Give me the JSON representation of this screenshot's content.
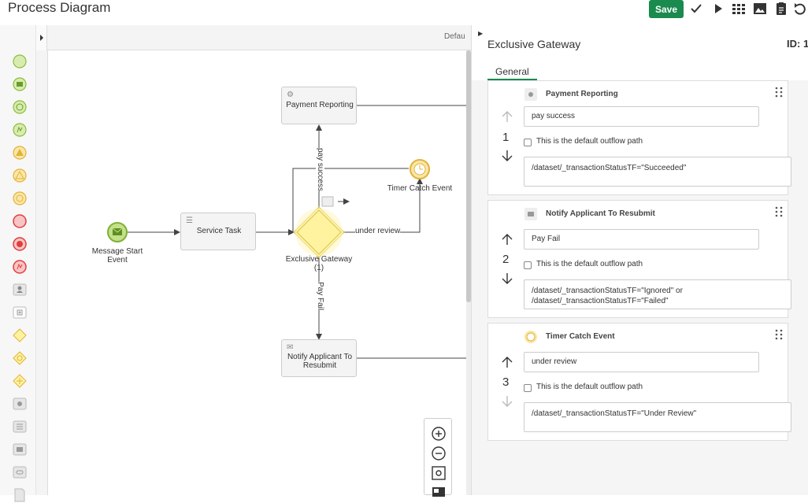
{
  "header": {
    "title": "Process Diagram",
    "save_label": "Save",
    "tools": [
      "check-icon",
      "play-icon",
      "grid-icon",
      "image-icon",
      "clipboard-icon",
      "undo-icon"
    ]
  },
  "canvas": {
    "default_label": "Defau",
    "elements": {
      "start_event": "Message Start\nEvent",
      "service_task": "Service Task",
      "payment_reporting": "Payment Reporting",
      "gateway": "Exclusive Gateway\n(1)",
      "timer": "Timer Catch Event",
      "notify": "Notify Applicant To\nResubmit",
      "flow_pay_success": "pay success",
      "flow_under_review": "under review",
      "flow_pay_fail": "Pay Fail"
    }
  },
  "panel": {
    "title": "Exclusive Gateway",
    "id_label": "ID: 1",
    "tab": "General",
    "flows": [
      {
        "target": "Payment Reporting",
        "icon": "gear-icon",
        "order": "1",
        "condition_name": "pay success",
        "default_label": "This is the default outflow path",
        "expression": "/dataset/_transactionStatusTF=\"Succeeded\""
      },
      {
        "target": "Notify Applicant To Resubmit",
        "icon": "envelope-icon",
        "order": "2",
        "condition_name": "Pay Fail",
        "default_label": "This is the default outflow path",
        "expression": "/dataset/_transactionStatusTF=\"Ignored\" or\n/dataset/_transactionStatusTF=\"Failed\""
      },
      {
        "target": "Timer Catch Event",
        "icon": "clock-icon",
        "order": "3",
        "condition_name": "under review",
        "default_label": "This is the default outflow path",
        "expression": "/dataset/_transactionStatusTF=\"Under Review\""
      }
    ]
  },
  "colors": {
    "accent": "#1a8a4f",
    "start_event": "#b5d77a",
    "gateway": "#fff3a0",
    "end_event": "#e33c3c"
  }
}
